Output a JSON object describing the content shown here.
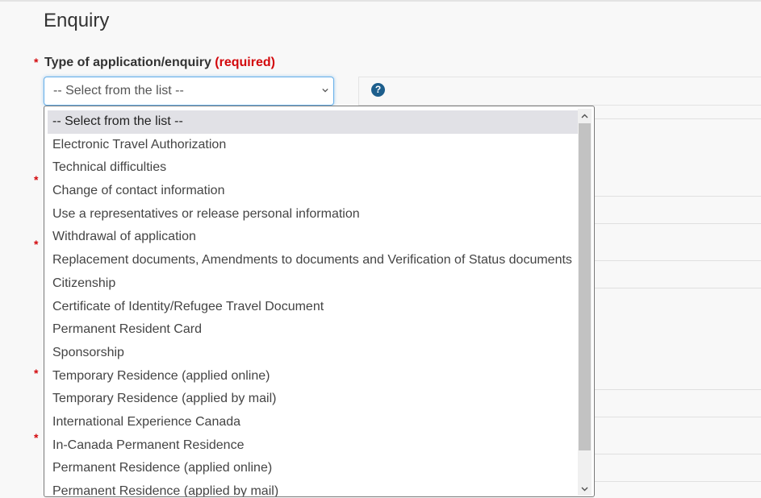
{
  "section": {
    "heading": "Enquiry"
  },
  "field": {
    "label": "Type of application/enquiry",
    "required_tag": "(required)",
    "required_star": "*",
    "selected_value": "-- Select from the list --"
  },
  "help": {
    "icon_glyph": "?"
  },
  "other_required_stars": [
    "*",
    "*",
    "*",
    "*"
  ],
  "dropdown": {
    "options": [
      "-- Select from the list --",
      "Electronic Travel Authorization",
      "Technical difficulties",
      "Change of contact information",
      "Use a representatives or release personal information",
      "Withdrawal of application",
      "Replacement documents, Amendments to documents and Verification of Status documents",
      "Citizenship",
      "Certificate of Identity/Refugee Travel Document",
      "Permanent Resident Card",
      "Sponsorship",
      "Temporary Residence (applied online)",
      "Temporary Residence (applied by mail)",
      "International Experience Canada",
      "In-Canada Permanent Residence",
      "Permanent Residence (applied online)",
      "Permanent Residence (applied by mail)"
    ],
    "selected_index": 0
  },
  "colors": {
    "required_red": "#d3080c",
    "focus_blue": "#66afe9",
    "help_icon_blue": "#1d5e8c",
    "selected_option_bg": "#e1e1e6"
  }
}
